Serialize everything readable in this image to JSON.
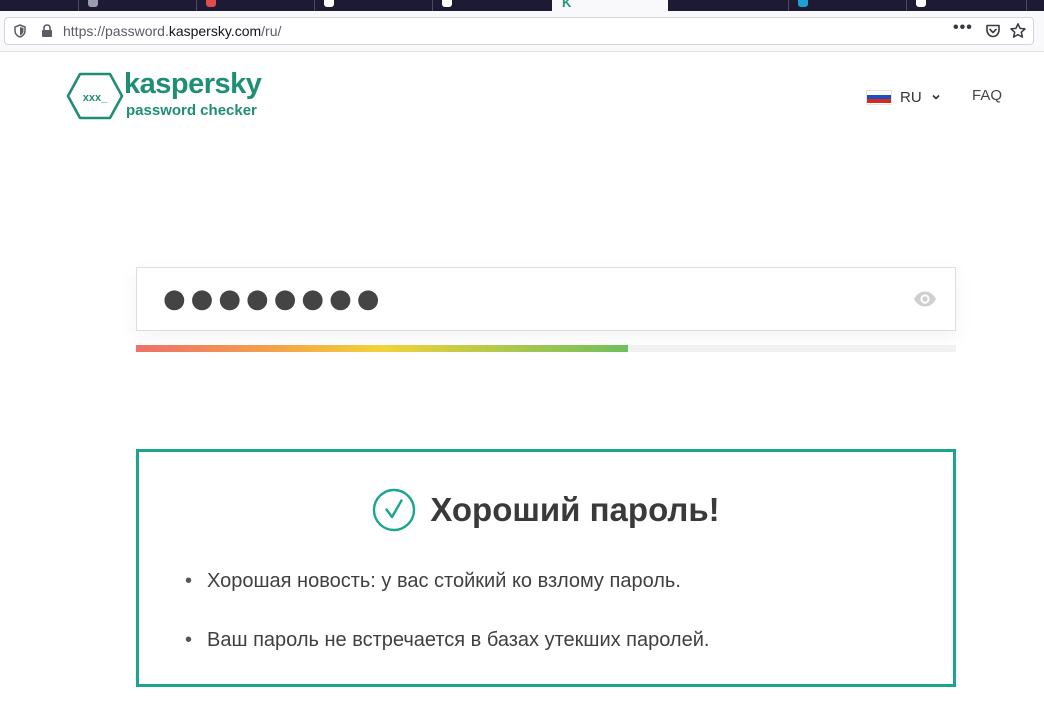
{
  "browser": {
    "url_prefix": "https://password.",
    "url_host": "kaspersky.com",
    "url_path": "/ru/",
    "active_tab_letter": "K",
    "menu_dots": "•••"
  },
  "header": {
    "brand": "kaspersky",
    "subtitle": "password checker",
    "logo_text": "xxx_",
    "lang_code": "RU",
    "faq_label": "FAQ",
    "flag_colors": [
      "#ffffff",
      "#1c4fbf",
      "#d52b1e"
    ]
  },
  "password": {
    "masked_value": "●●●●●●●●",
    "strength": 0.6
  },
  "result": {
    "title": "Хороший пароль!",
    "bullets": [
      "Хорошая новость: у вас стойкий ко взлому пароль.",
      "Ваш пароль не встречается в базах утекших паролей."
    ]
  },
  "colors": {
    "brand": "#1e8f74",
    "result_border": "#1aa58e"
  },
  "icons": {
    "shield": "shield-icon",
    "lock": "lock-icon",
    "pocket": "pocket-icon",
    "star": "star-icon",
    "eye": "eye-icon",
    "check": "check-circle-icon",
    "chevron": "chevron-down-icon"
  }
}
